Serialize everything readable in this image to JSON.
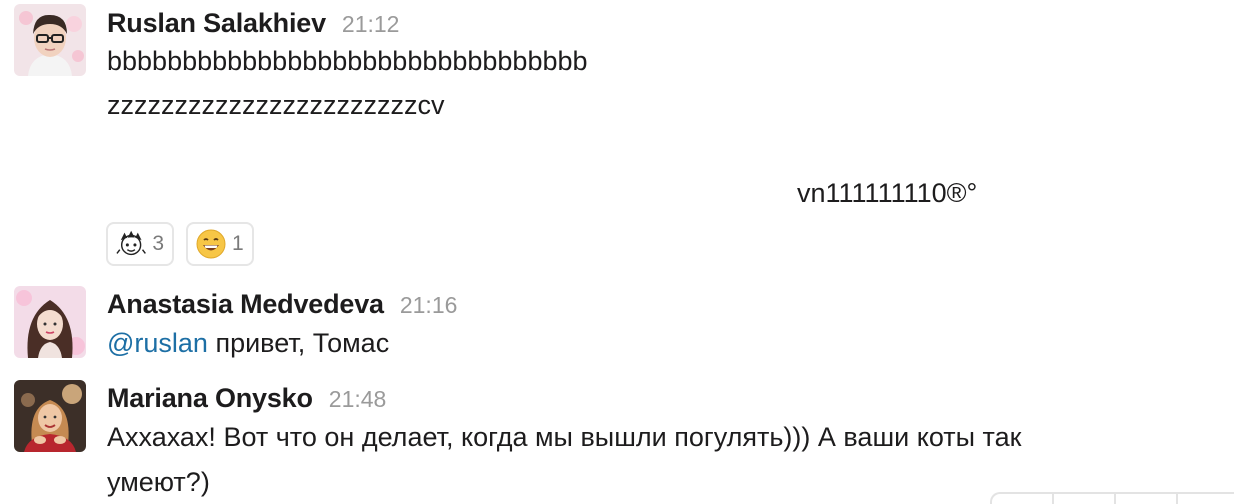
{
  "messages": [
    {
      "author": "Ruslan Salakhiev",
      "time": "21:12",
      "lines": [
        "bbbbbbbbbbbbbbbbbbbbbbbbbbbbbbbb",
        "zzzzzzzzzzzzzzzzzzzzzzzcv",
        "vn111111110®°"
      ],
      "reactions": [
        {
          "icon": "cartoon-face-icon",
          "count": "3"
        },
        {
          "icon": "grinning-face-emoji-icon",
          "count": "1"
        }
      ]
    },
    {
      "author": "Anastasia Medvedeva",
      "time": "21:16",
      "mention": "@ruslan",
      "text": " привет, Томас"
    },
    {
      "author": "Mariana Onysko",
      "time": "21:48",
      "lines": [
        "Аххахах! Вот что он делает, когда мы вышли погулять))) А ваши коты так",
        "умеют?)"
      ]
    }
  ],
  "colors": {
    "mention": "#1d6fa5",
    "timestamp": "#9a9a9a",
    "text": "#1d1c1d",
    "reaction_border": "#e6e6e6"
  }
}
